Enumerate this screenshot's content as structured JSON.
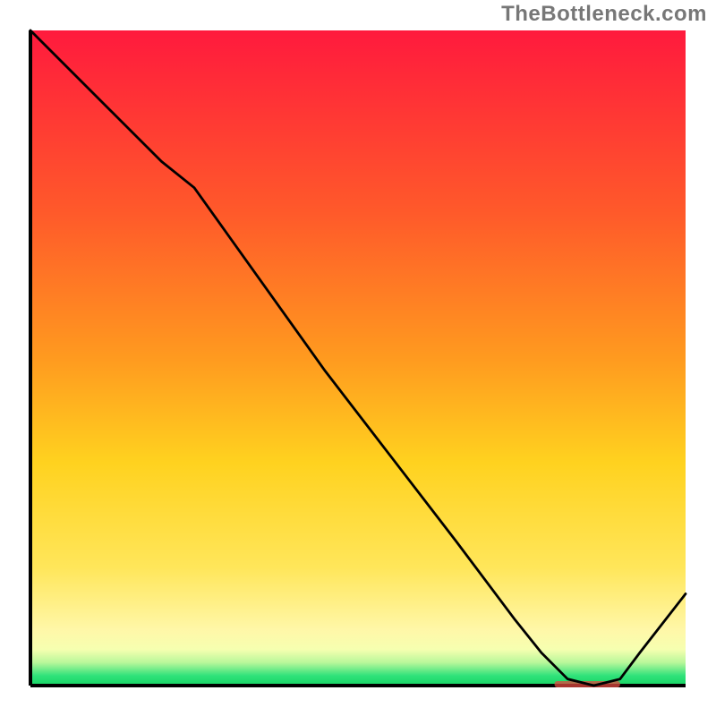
{
  "watermark": "TheBottleneck.com",
  "xlabel": "",
  "ylabel": "",
  "marker_label": "",
  "chart_data": {
    "type": "line",
    "title": "",
    "xlabel": "",
    "ylabel": "",
    "xlim": [
      0,
      100
    ],
    "ylim": [
      0,
      100
    ],
    "series": [
      {
        "name": "curve",
        "x": [
          0,
          5,
          12,
          20,
          25,
          35,
          45,
          55,
          65,
          74,
          78,
          82,
          86,
          90,
          93,
          100
        ],
        "values": [
          100,
          95,
          88,
          80,
          76,
          62,
          48,
          35,
          22,
          10,
          5,
          1,
          0,
          1,
          5,
          14
        ]
      }
    ],
    "background_gradient": {
      "top_color": "#ff1a3d",
      "mid_upper_color": "#ff9a1f",
      "mid_color": "#ffd21f",
      "mid_lower_color": "#ffe65a",
      "lower_band_color": "#fff7a8",
      "green_band_color": "#2fe27a",
      "bottom_color": "#17d464"
    },
    "optimal_marker": {
      "x_start": 80,
      "x_end": 90,
      "y": 0
    },
    "axis_color": "#000000",
    "curve_color": "#000000",
    "curve_width": 2.8
  }
}
